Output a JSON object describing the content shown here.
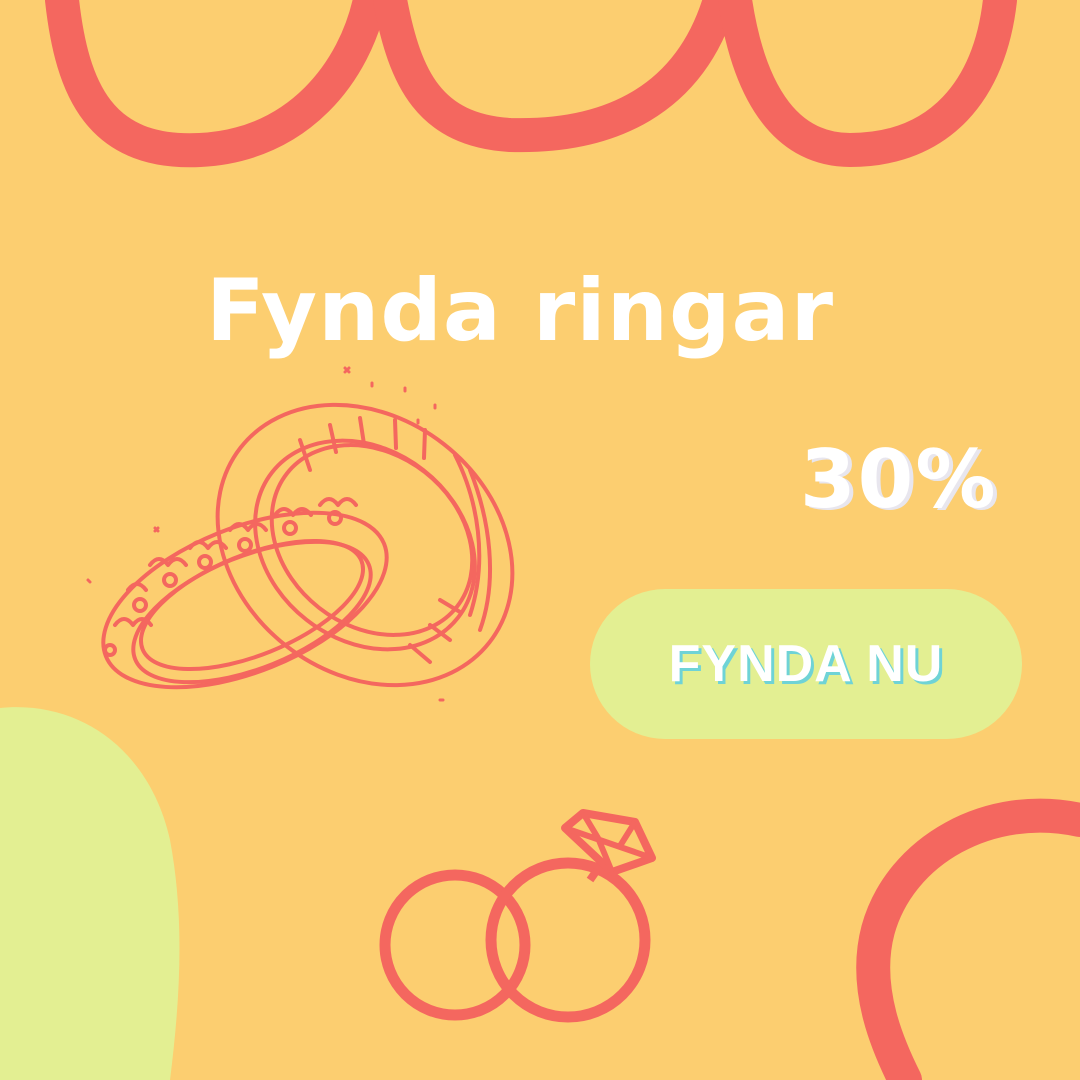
{
  "headline": "Fynda ringar",
  "discount": "30%",
  "cta": {
    "label": "FYNDA NU"
  },
  "colors": {
    "background": "#fcce70",
    "accent": "#f4675f",
    "lime": "#e3ef92",
    "text": "#ffffff",
    "cta_shadow": "#6fd3d6"
  },
  "icons": [
    "wedding-bands-illustration",
    "wedding-rings-diamond-icon"
  ]
}
